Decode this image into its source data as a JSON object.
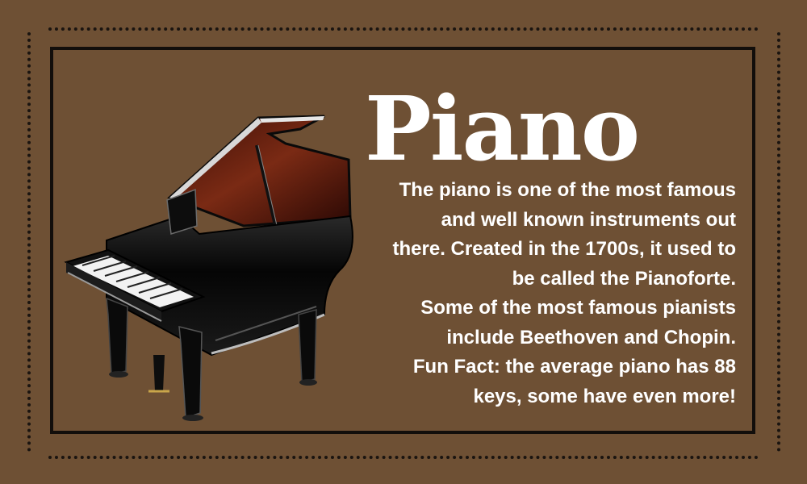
{
  "title": "Piano",
  "description_lines": [
    "The piano is one of the most famous",
    "and well known instruments out",
    "there. Created in the 1700s, it used to",
    "be called the Pianoforte.",
    "Some of the most famous pianists",
    "include Beethoven and Chopin.",
    "Fun Fact: the average piano has 88",
    "keys, some have even more!"
  ],
  "colors": {
    "background": "#6e5034",
    "frame": "#120e0b",
    "text": "#ffffff"
  },
  "icons": [
    "grand-piano-illustration"
  ]
}
